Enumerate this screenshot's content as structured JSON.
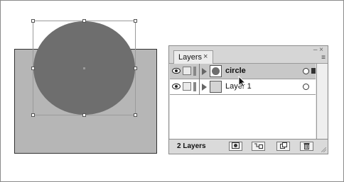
{
  "panel": {
    "tab_label": "Layers",
    "close_glyph": "×",
    "minimize_glyph": "–",
    "window_close_glyph": "×",
    "menu_glyph": "≡",
    "layer_count": "2 Layers"
  },
  "layers": [
    {
      "name": "circle",
      "selected": true
    },
    {
      "name": "Layer 1",
      "selected": false
    }
  ],
  "bottom_buttons": [
    "make-clipping-mask",
    "create-sublayer",
    "create-layer",
    "delete-layer"
  ],
  "colors": {
    "artwork_fill": "#6e6e6e",
    "background_rect": "#b6b6b6",
    "selected_row": "#c8c8c8"
  }
}
